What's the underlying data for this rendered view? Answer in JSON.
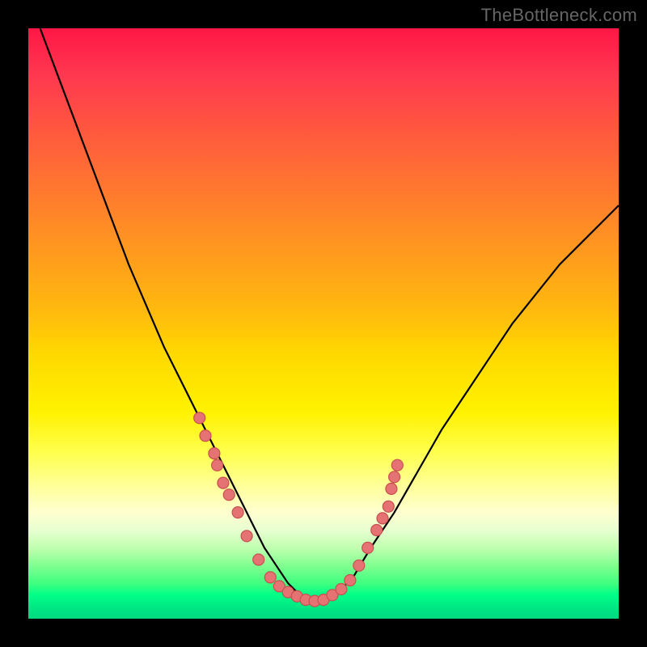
{
  "watermark": "TheBottleneck.com",
  "colors": {
    "dot_fill": "#e57373",
    "dot_stroke": "#c94f4f",
    "curve": "#000000"
  },
  "chart_data": {
    "type": "line",
    "title": "",
    "xlabel": "",
    "ylabel": "",
    "xlim": [
      0,
      100
    ],
    "ylim": [
      0,
      100
    ],
    "grid": false,
    "series": [
      {
        "name": "curve",
        "x": [
          2,
          5,
          8,
          11,
          14,
          17,
          20,
          23,
          26,
          29,
          32,
          34,
          36,
          38,
          40,
          42,
          44,
          46,
          48,
          50,
          52,
          55,
          58,
          62,
          66,
          70,
          74,
          78,
          82,
          86,
          90,
          94,
          98,
          100
        ],
        "y": [
          100,
          92,
          84,
          76,
          68,
          60,
          53,
          46,
          40,
          34,
          28,
          24,
          20,
          16,
          12,
          9,
          6,
          4,
          3,
          3,
          4,
          7,
          12,
          18,
          25,
          32,
          38,
          44,
          50,
          55,
          60,
          64,
          68,
          70
        ]
      }
    ],
    "dots": {
      "name": "markers",
      "points": [
        {
          "x": 29,
          "y": 34
        },
        {
          "x": 30,
          "y": 31
        },
        {
          "x": 31.5,
          "y": 28
        },
        {
          "x": 32,
          "y": 26
        },
        {
          "x": 33,
          "y": 23
        },
        {
          "x": 34,
          "y": 21
        },
        {
          "x": 35.5,
          "y": 18
        },
        {
          "x": 37,
          "y": 14
        },
        {
          "x": 39,
          "y": 10
        },
        {
          "x": 41,
          "y": 7
        },
        {
          "x": 42.5,
          "y": 5.5
        },
        {
          "x": 44,
          "y": 4.5
        },
        {
          "x": 45.5,
          "y": 3.8
        },
        {
          "x": 47,
          "y": 3.2
        },
        {
          "x": 48.5,
          "y": 3
        },
        {
          "x": 50,
          "y": 3.2
        },
        {
          "x": 51.5,
          "y": 4
        },
        {
          "x": 53,
          "y": 5
        },
        {
          "x": 54.5,
          "y": 6.5
        },
        {
          "x": 56,
          "y": 9
        },
        {
          "x": 57.5,
          "y": 12
        },
        {
          "x": 59,
          "y": 15
        },
        {
          "x": 60,
          "y": 17
        },
        {
          "x": 61,
          "y": 19
        },
        {
          "x": 61.5,
          "y": 22
        },
        {
          "x": 62,
          "y": 24
        },
        {
          "x": 62.5,
          "y": 26
        }
      ]
    }
  }
}
